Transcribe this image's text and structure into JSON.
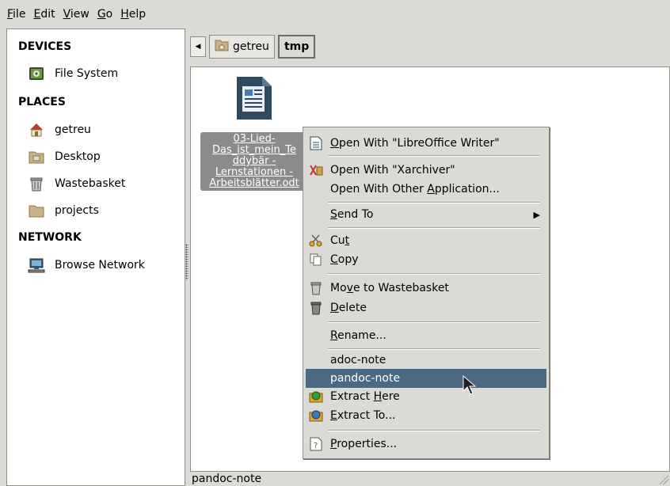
{
  "menubar": {
    "items": [
      {
        "key": "F",
        "rest": "ile"
      },
      {
        "key": "E",
        "rest": "dit"
      },
      {
        "key": "V",
        "rest": "iew"
      },
      {
        "key": "G",
        "rest": "o"
      },
      {
        "key": "H",
        "rest": "elp"
      }
    ]
  },
  "sidepane": {
    "devices_header": "DEVICES",
    "file_system": "File System",
    "places_header": "PLACES",
    "places": [
      "getreu",
      "Desktop",
      "Wastebasket",
      "projects"
    ],
    "network_header": "NETWORK",
    "browse_network": "Browse Network"
  },
  "pathbar": {
    "home": "getreu",
    "current": "tmp"
  },
  "file": {
    "name_lines": [
      "03-Lied-",
      "Das_ist_mein_Te",
      "ddybär -",
      "Lernstationen -",
      "Arbeitsblätter.odt"
    ]
  },
  "context_menu": {
    "open_with_writer": {
      "pre": "",
      "key": "O",
      "post": "pen With \"LibreOffice Writer\""
    },
    "open_with_xarchiver": "Open With \"Xarchiver\"",
    "open_with_other": {
      "pre": "Open With Other ",
      "key": "A",
      "post": "pplication..."
    },
    "send_to": {
      "pre": "",
      "key": "S",
      "post": "end To"
    },
    "cut": {
      "pre": "Cu",
      "key": "t",
      "post": ""
    },
    "copy": {
      "pre": "",
      "key": "C",
      "post": "opy"
    },
    "move_to_wastebasket": {
      "pre": "Mo",
      "key": "v",
      "post": "e to Wastebasket"
    },
    "delete": {
      "pre": "",
      "key": "D",
      "post": "elete"
    },
    "rename": {
      "pre": "",
      "key": "R",
      "post": "ename..."
    },
    "adoc_note": "adoc-note",
    "pandoc_note": "pandoc-note",
    "extract_here": {
      "pre": "Extract ",
      "key": "H",
      "post": "ere"
    },
    "extract_to": {
      "pre": "",
      "key": "E",
      "post": "xtract To..."
    },
    "properties": {
      "pre": "",
      "key": "P",
      "post": "roperties..."
    }
  },
  "statusbar": {
    "text": "pandoc-note"
  },
  "colors": {
    "highlight": "#4b6983",
    "window_bg": "#dcdad5",
    "file_label_bg": "#8a8c8c"
  }
}
